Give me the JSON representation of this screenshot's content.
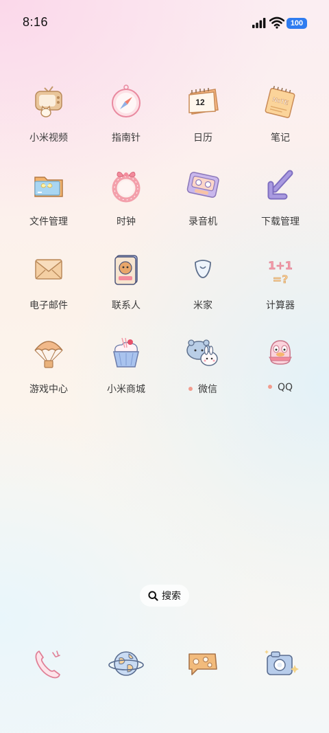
{
  "status_bar": {
    "time": "8:16",
    "battery": "100"
  },
  "apps": [
    {
      "label": "小米视频",
      "icon": "tv-icon",
      "dot": false
    },
    {
      "label": "指南针",
      "icon": "compass-icon",
      "dot": false
    },
    {
      "label": "日历",
      "icon": "calendar-icon",
      "dot": false,
      "day": "12"
    },
    {
      "label": "笔记",
      "icon": "note-icon",
      "dot": false,
      "text": "NoTE"
    },
    {
      "label": "文件管理",
      "icon": "folder-icon",
      "dot": false
    },
    {
      "label": "时钟",
      "icon": "clock-icon",
      "dot": false
    },
    {
      "label": "录音机",
      "icon": "recorder-icon",
      "dot": false
    },
    {
      "label": "下载管理",
      "icon": "download-icon",
      "dot": false
    },
    {
      "label": "电子邮件",
      "icon": "mail-icon",
      "dot": false
    },
    {
      "label": "联系人",
      "icon": "contacts-icon",
      "dot": false
    },
    {
      "label": "米家",
      "icon": "mijia-icon",
      "dot": false
    },
    {
      "label": "计算器",
      "icon": "calculator-icon",
      "dot": false,
      "text": "1+1=?"
    },
    {
      "label": "游戏中心",
      "icon": "parachute-icon",
      "dot": false
    },
    {
      "label": "小米商城",
      "icon": "cupcake-icon",
      "dot": false
    },
    {
      "label": "微信",
      "icon": "wechat-icon",
      "dot": true
    },
    {
      "label": "QQ",
      "icon": "qq-icon",
      "dot": true
    }
  ],
  "search": {
    "label": "搜索"
  },
  "dock": [
    {
      "icon": "phone-icon"
    },
    {
      "icon": "browser-globe-icon"
    },
    {
      "icon": "messages-icon"
    },
    {
      "icon": "camera-icon"
    }
  ]
}
